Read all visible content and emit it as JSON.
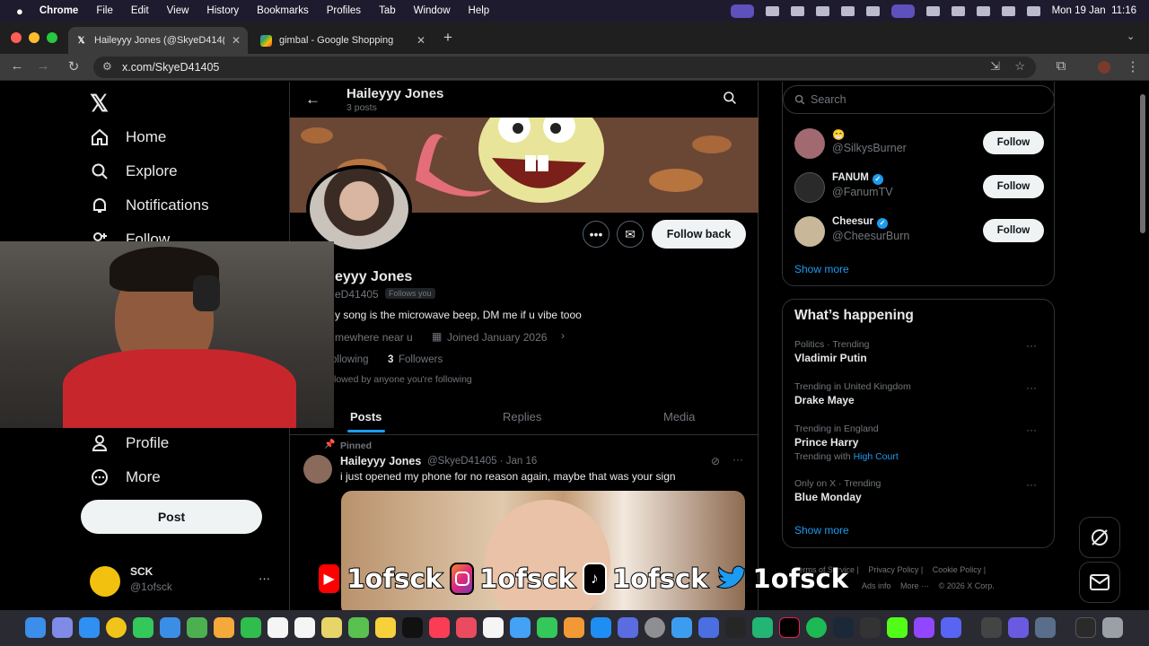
{
  "menubar": {
    "app": "Chrome",
    "items": [
      "File",
      "Edit",
      "View",
      "History",
      "Bookmarks",
      "Profiles",
      "Tab",
      "Window",
      "Help"
    ],
    "clock": "Mon 19 Jan  11:16"
  },
  "browser": {
    "tabs": [
      {
        "title": "Haileyyy Jones (@SkyeD414("
      },
      {
        "title": "gimbal - Google Shopping"
      }
    ],
    "url": "x.com/SkyeD41405"
  },
  "left_nav": {
    "items": [
      {
        "label": "Home",
        "icon": "home-icon"
      },
      {
        "label": "Explore",
        "icon": "search-icon"
      },
      {
        "label": "Notifications",
        "icon": "bell-icon"
      },
      {
        "label": "Follow",
        "icon": "person-plus-icon"
      },
      {
        "label": "Profile",
        "icon": "person-icon"
      },
      {
        "label": "More",
        "icon": "more-circle-icon"
      }
    ],
    "post_label": "Post",
    "account": {
      "name": "SCK",
      "handle": "@1ofsck",
      "menu": "···"
    }
  },
  "profile": {
    "header_name": "Haileyyy Jones",
    "header_posts": "3 posts",
    "follow_back_label": "Follow back",
    "display_name": "eyyy Jones",
    "handle": "eD41405",
    "follows_you": "Follows you",
    "bio": "y song is the microwave beep, DM me if u vibe tooo",
    "location": "mewhere near u",
    "joined": "Joined January 2026",
    "following_label": "ollowing",
    "followers_count": "3",
    "followers_label": "Followers",
    "followed_by": "lowed by anyone you're following",
    "tabs": [
      "Posts",
      "Replies",
      "Media"
    ]
  },
  "pinned_post": {
    "pinned_label": "Pinned",
    "author": "Haileyyy Jones",
    "meta": "@SkyeD41405 · Jan 16",
    "text": "i just opened my phone for no reason again, maybe that was your sign"
  },
  "right": {
    "search_placeholder": "Search",
    "who_to_follow": [
      {
        "name": "😁",
        "handle": "@SilkysBurner",
        "verified": false,
        "button": "Follow"
      },
      {
        "name": "FANUM",
        "handle": "@FanumTV",
        "verified": true,
        "button": "Follow"
      },
      {
        "name": "Cheesur",
        "handle": "@CheesurBurn",
        "verified": true,
        "button": "Follow"
      }
    ],
    "show_more": "Show more",
    "happening_title": "What’s happening",
    "trends": [
      {
        "context": "Politics · Trending",
        "name": "Vladimir Putin"
      },
      {
        "context": "Trending in United Kingdom",
        "name": "Drake Maye"
      },
      {
        "context": "Trending in England",
        "name": "Prince Harry",
        "extra_prefix": "Trending with",
        "extra_link": "High Court"
      },
      {
        "context": "Only on X · Trending",
        "name": "Blue Monday"
      }
    ],
    "show_more_2": "Show more",
    "footer": [
      "Terms of Service |",
      "Privacy Policy |",
      "Cookie Policy |",
      "Ads info",
      "More ···",
      "© 2026 X Corp."
    ]
  },
  "overlay": {
    "social_handles": [
      "1ofsck",
      "1ofsck",
      "1ofsck",
      "1ofsck"
    ],
    "social_icons": [
      "youtube-icon",
      "instagram-icon",
      "tiktok-icon",
      "twitter-bird-icon"
    ]
  },
  "colors": {
    "accent": "#1d9bf0",
    "background": "#000000",
    "text": "#e7e9ea",
    "muted": "#71767b",
    "border": "#2f3336"
  }
}
